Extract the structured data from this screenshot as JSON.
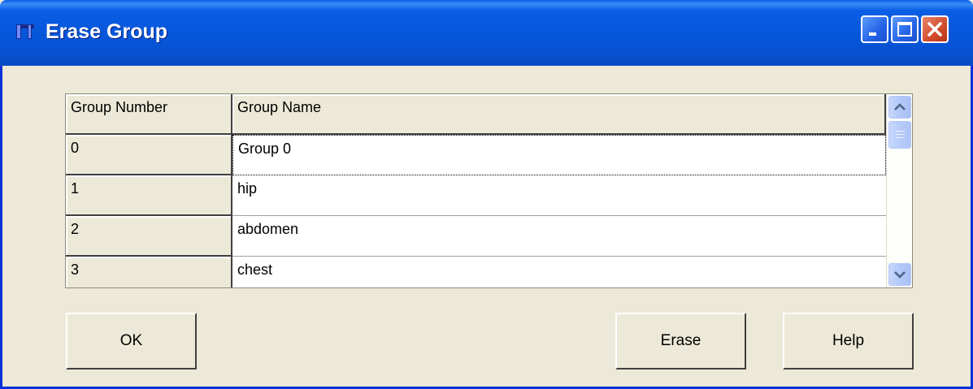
{
  "window": {
    "title": "Erase Group",
    "controls": {
      "minimize": "minimize-icon",
      "maximize": "maximize-icon",
      "close": "close-icon"
    }
  },
  "table": {
    "columns": [
      "Group Number",
      "Group Name"
    ],
    "rows": [
      {
        "number": "0",
        "name": "Group 0"
      },
      {
        "number": "1",
        "name": "hip"
      },
      {
        "number": "2",
        "name": "abdomen"
      },
      {
        "number": "3",
        "name": "chest"
      }
    ],
    "selected_row": 0
  },
  "buttons": {
    "ok": "OK",
    "erase": "Erase",
    "help": "Help"
  },
  "colors": {
    "titlebar": "#0a5ee5",
    "dialog_bg": "#ece9d8",
    "close_button": "#d24b2b",
    "scrollbar": "#b2c8f8"
  }
}
